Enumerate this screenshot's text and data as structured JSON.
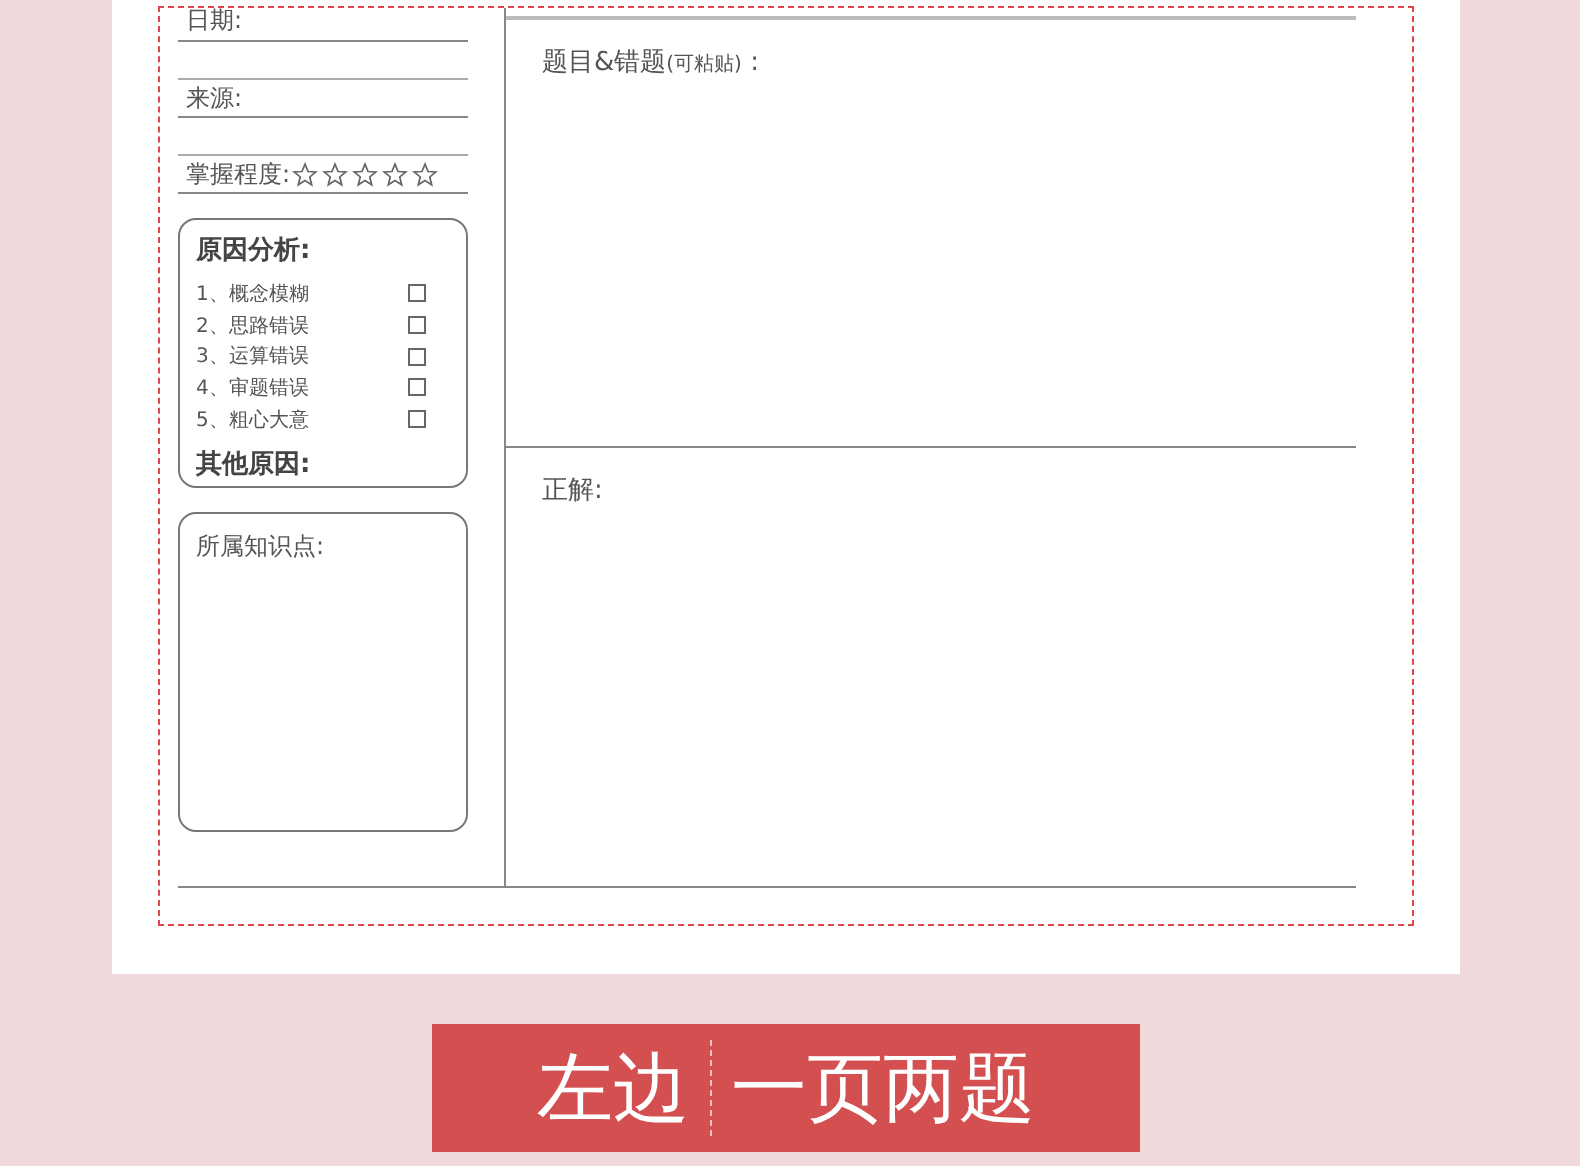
{
  "fields": [
    {
      "kind": "text",
      "label": "日期:"
    },
    {
      "kind": "text",
      "label": "来源:"
    },
    {
      "kind": "rating",
      "label": "掌握程度:",
      "stars": 0
    }
  ],
  "causes": {
    "title": "原因分析:",
    "items": [
      {
        "label": "1、概念模糊",
        "checked": false
      },
      {
        "label": "2、思路错误",
        "checked": false
      },
      {
        "label": "3、运算错误",
        "checked": false
      },
      {
        "label": "4、审题错误",
        "checked": false
      },
      {
        "label": "5、粗心大意",
        "checked": false
      }
    ],
    "other": "其他原因:"
  },
  "knowledge": {
    "label": "所属知识点:"
  },
  "question": {
    "label": "题目&错题",
    "note": "(可粘贴)",
    "colon": ":"
  },
  "answer": {
    "label": "正解:"
  },
  "banner": {
    "left": "左边",
    "right": "一页两题"
  }
}
